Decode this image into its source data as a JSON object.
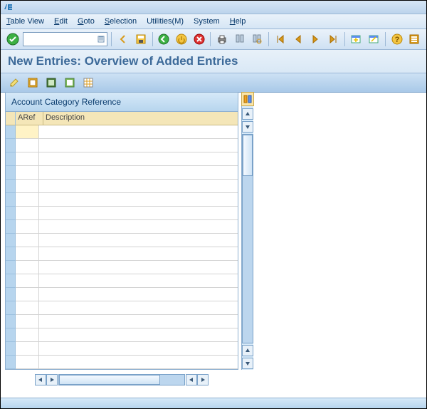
{
  "menu": {
    "tableview": "Table View",
    "edit": "Edit",
    "goto": "Goto",
    "selection": "Selection",
    "utilities": "Utilities(M)",
    "system": "System",
    "help": "Help"
  },
  "title": "New Entries: Overview of Added Entries",
  "panel": {
    "header": "Account Category Reference"
  },
  "columns": {
    "aref": "ARef",
    "desc": "Description"
  },
  "row_count": 18
}
